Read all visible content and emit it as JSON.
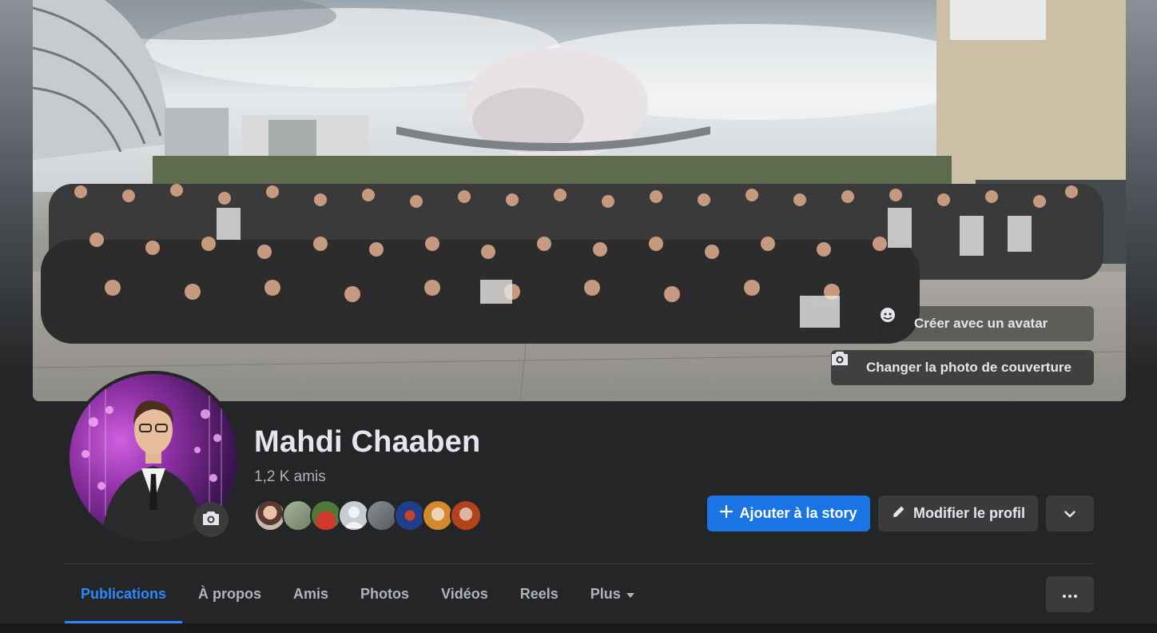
{
  "cover": {
    "avatar_button_label": "Créer avec un avatar",
    "change_cover_label": "Changer la photo de couverture"
  },
  "profile": {
    "name": "Mahdi Chaaben",
    "friends_count": "1,2 K amis",
    "friend_faces": [
      "friend-1",
      "friend-2",
      "friend-3",
      "friend-4",
      "friend-5",
      "friend-6",
      "friend-7",
      "friend-8"
    ]
  },
  "actions": {
    "add_story": "Ajouter à la story",
    "edit_profile": "Modifier le profil"
  },
  "tabs": [
    {
      "label": "Publications",
      "active": true
    },
    {
      "label": "À propos",
      "active": false
    },
    {
      "label": "Amis",
      "active": false
    },
    {
      "label": "Photos",
      "active": false
    },
    {
      "label": "Vidéos",
      "active": false
    },
    {
      "label": "Reels",
      "active": false
    },
    {
      "label": "Plus",
      "active": false
    }
  ],
  "colors": {
    "accent": "#1b74e4",
    "active_tab": "#2d88ff",
    "surface": "#242526",
    "button": "#3a3b3c",
    "text_primary": "#e4e6eb",
    "text_secondary": "#b0b3b8"
  }
}
